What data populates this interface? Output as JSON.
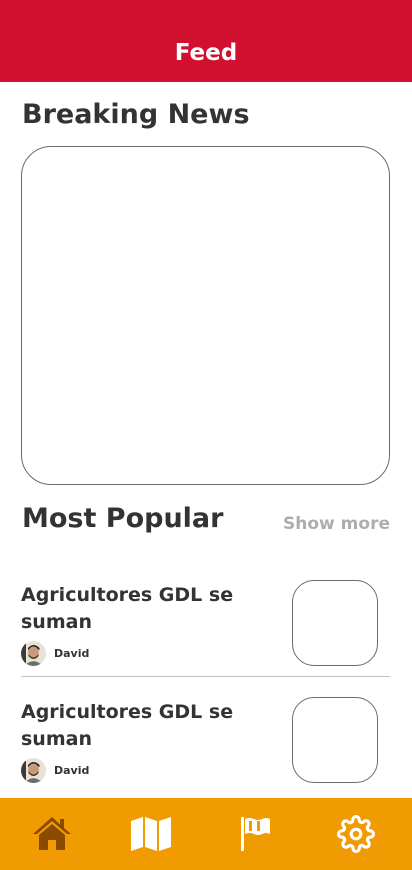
{
  "header": {
    "title": "Feed"
  },
  "breaking_news": {
    "title": "Breaking News"
  },
  "most_popular": {
    "title": "Most Popular",
    "show_more_label": "Show more",
    "items": [
      {
        "title": "Agricultores GDL se suman",
        "author": "David"
      },
      {
        "title": "Agricultores GDL se suman",
        "author": "David"
      }
    ]
  },
  "bottom_nav": {
    "items": [
      {
        "icon": "home-icon",
        "active": true
      },
      {
        "icon": "map-icon",
        "active": false
      },
      {
        "icon": "flag-icon",
        "active": false
      },
      {
        "icon": "settings-icon",
        "active": false
      }
    ]
  },
  "colors": {
    "header": "#d10f2f",
    "nav_bar": "#f19b03",
    "nav_active_icon": "#8a4a00",
    "nav_icon": "#ffffff",
    "show_more": "#adadad"
  }
}
